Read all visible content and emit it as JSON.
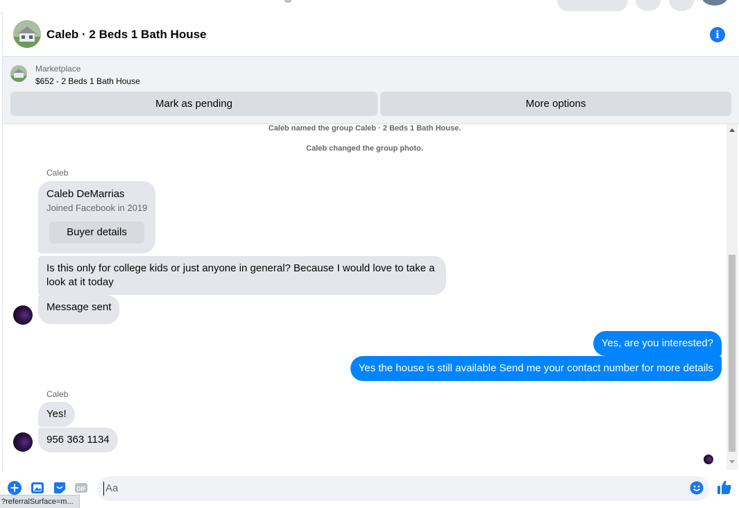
{
  "colors": {
    "accent": "#1877f2",
    "outgoing_bubble": "#0084ff",
    "incoming_bubble": "#e4e6eb"
  },
  "header": {
    "title": "Caleb · 2 Beds 1 Bath House",
    "info_icon": "info-icon"
  },
  "marketplace": {
    "label": "Marketplace",
    "listing": "$652 - 2 Beds 1 Bath House",
    "mark_pending": "Mark as pending",
    "more_options": "More options"
  },
  "chat": {
    "system": [
      "Caleb named the group Caleb · 2 Beds 1 Bath House.",
      "Caleb changed the group photo."
    ],
    "sender_name": "Caleb",
    "card": {
      "name": "Caleb DeMarrias",
      "joined": "Joined Facebook in 2019",
      "button": "Buyer details"
    },
    "incoming": [
      "Is this only for college kids or just anyone in general? Because I would love to take a look at it today",
      "Message sent",
      "Yes!",
      "956 363 1134"
    ],
    "outgoing": [
      "Yes, are you interested?",
      "Yes the house is still available Send me your contact number for more details"
    ]
  },
  "composer": {
    "placeholder": "Aa",
    "icons": [
      "plus-icon",
      "image-icon",
      "sticker-icon",
      "gif-icon",
      "emoji-icon",
      "like-icon"
    ],
    "gif_label": "GIF"
  },
  "status_bar": {
    "url": "?referralSurface=m..."
  }
}
